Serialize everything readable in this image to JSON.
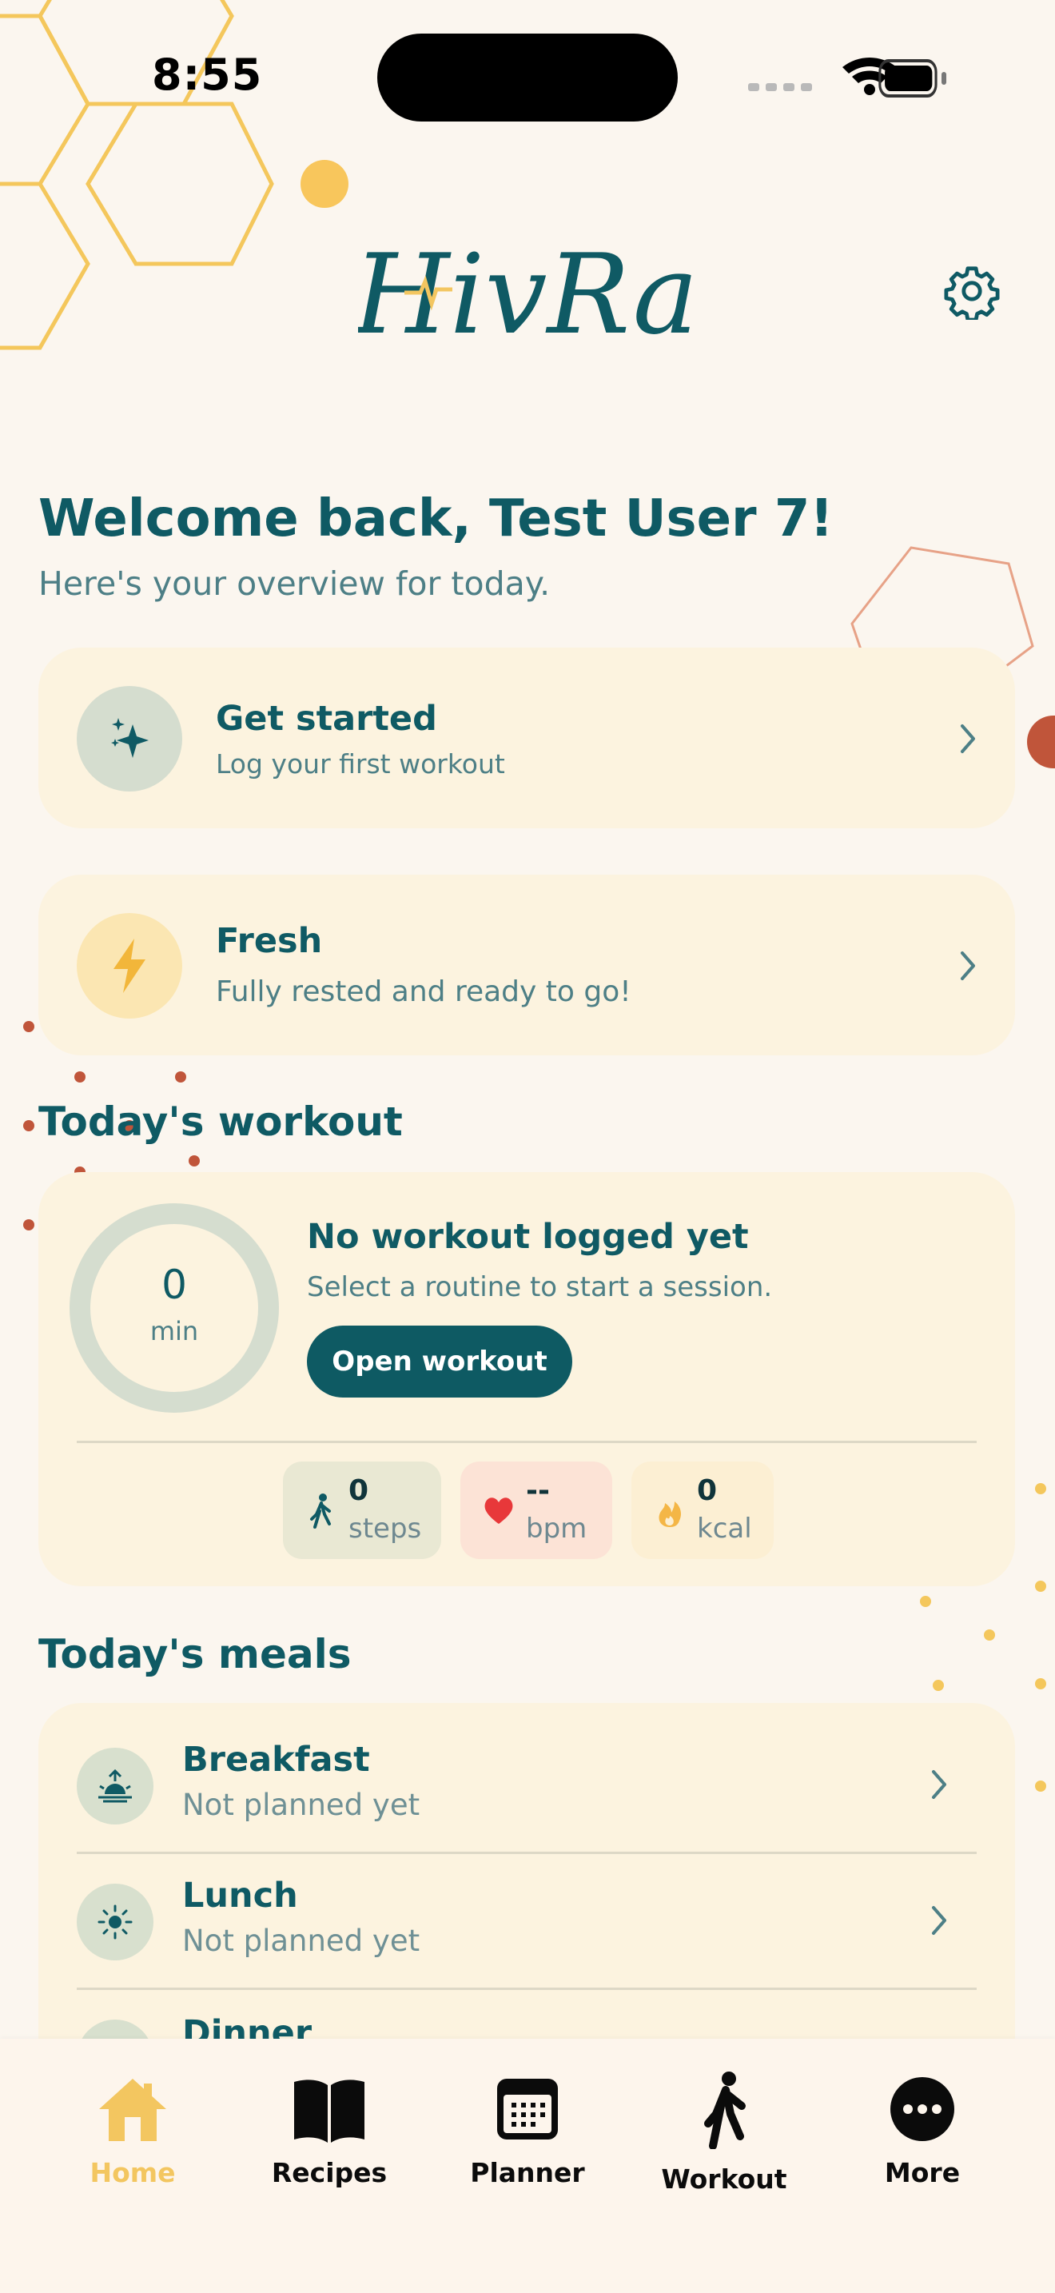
{
  "status_bar": {
    "time": "8:55"
  },
  "header": {
    "app_name": "HivRa",
    "settings_icon": "gear-icon"
  },
  "welcome": {
    "title": "Welcome back, Test User 7!",
    "subtitle": "Here's your overview for today."
  },
  "get_started": {
    "icon": "sparkles-icon",
    "title": "Get started",
    "subtitle": "Log your first workout"
  },
  "readiness": {
    "icon": "lightning-icon",
    "title": "Fresh",
    "subtitle": "Fully rested and ready to go!"
  },
  "workout": {
    "section_title": "Today's workout",
    "ring_value": "0",
    "ring_unit": "min",
    "ring_progress": 0,
    "title": "No workout logged yet",
    "subtitle": "Select a routine to start a session.",
    "button_label": "Open workout",
    "stats": [
      {
        "icon": "walking-icon",
        "value": "0",
        "unit": "steps"
      },
      {
        "icon": "heart-icon",
        "value": "--",
        "unit": "bpm"
      },
      {
        "icon": "flame-icon",
        "value": "0",
        "unit": "kcal"
      }
    ]
  },
  "meals": {
    "section_title": "Today's meals",
    "items": [
      {
        "icon": "sunrise-icon",
        "title": "Breakfast",
        "subtitle": "Not planned yet"
      },
      {
        "icon": "sun-icon",
        "title": "Lunch",
        "subtitle": "Not planned yet"
      },
      {
        "icon": "moon-icon",
        "title": "Dinner",
        "subtitle": ""
      }
    ]
  },
  "tabs": [
    {
      "label": "Home",
      "icon": "home-icon",
      "active": true
    },
    {
      "label": "Recipes",
      "icon": "book-icon",
      "active": false
    },
    {
      "label": "Planner",
      "icon": "calendar-icon",
      "active": false
    },
    {
      "label": "Workout",
      "icon": "walking-icon",
      "active": false
    },
    {
      "label": "More",
      "icon": "more-icon",
      "active": false
    }
  ],
  "colors": {
    "primary": "#0E5A63",
    "accent": "#F3C660",
    "card": "#FCF3DF",
    "background": "#FBF6EF",
    "decor_orange": "#C0553A"
  }
}
